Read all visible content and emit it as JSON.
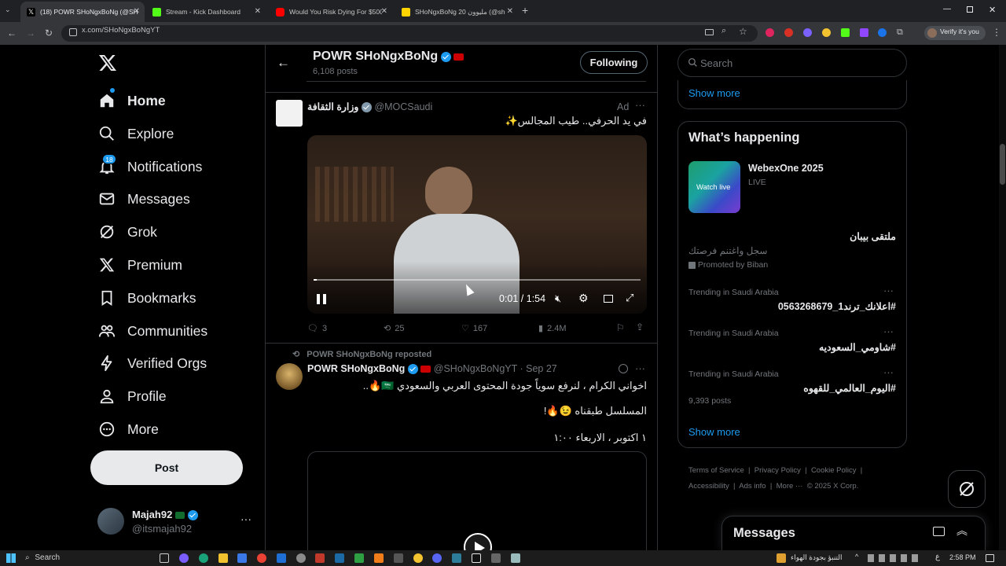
{
  "browser": {
    "tabs": [
      {
        "title": "(18) POWR SHoNgxBoNg (@SH",
        "favicon_color": "#ffffff",
        "active": true
      },
      {
        "title": "Stream - Kick Dashboard",
        "favicon_color": "#53fc18",
        "active": false
      },
      {
        "title": "Would You Risk Dying For $500",
        "favicon_color": "#ff0000",
        "active": false
      },
      {
        "title": "SHoNgxBoNg 20 مليوون (@sh",
        "favicon_color": "#ffd400",
        "active": false
      }
    ],
    "url": "x.com/SHoNgxBoNgYT",
    "profile_label": "Verify it's you"
  },
  "sidebar": {
    "items": [
      {
        "label": "Home",
        "icon": "home-icon"
      },
      {
        "label": "Explore",
        "icon": "search-icon"
      },
      {
        "label": "Notifications",
        "icon": "bell-icon",
        "badge": "18"
      },
      {
        "label": "Messages",
        "icon": "envelope-icon"
      },
      {
        "label": "Grok",
        "icon": "grok-icon"
      },
      {
        "label": "Premium",
        "icon": "x-logo-icon"
      },
      {
        "label": "Bookmarks",
        "icon": "bookmark-icon"
      },
      {
        "label": "Communities",
        "icon": "people-icon"
      },
      {
        "label": "Verified Orgs",
        "icon": "lightning-icon"
      },
      {
        "label": "Profile",
        "icon": "person-icon"
      },
      {
        "label": "More",
        "icon": "more-circle-icon"
      }
    ],
    "post_label": "Post",
    "account": {
      "name": "Majah92",
      "handle": "@itsmajah92"
    }
  },
  "header": {
    "title": "POWR SHoNgxBoNg",
    "posts_count": "6,108 posts",
    "following_label": "Following"
  },
  "ad_tweet": {
    "name": "وزارة الثقافة",
    "handle": "@MOCSaudi",
    "ad_label": "Ad",
    "text": "في يد الحرفي.. طيب المجالس✨",
    "video_time": "0:01 / 1:54",
    "video_progress": 0.01,
    "replies": "3",
    "reposts": "25",
    "likes": "167",
    "views": "2.4M"
  },
  "repost_tweet": {
    "reposted_by": "POWR SHoNgxBoNg reposted",
    "name": "POWR SHoNgxBoNg",
    "handle": "@SHoNgxBoNgYT",
    "date": "· Sep 27",
    "line1": "اخواني الكرام ، لنرفع سوياً جودة المحتوى العربي والسعودي 🇸🇦🔥..",
    "line2": "المسلسل طبقناه 😉🔥!",
    "line3": "١ اكتوبر ، الاربعاء ١:٠٠"
  },
  "right": {
    "search_placeholder": "Search",
    "show_more_top": "Show more",
    "happening_title": "What’s happening",
    "event": {
      "title": "WebexOne 2025",
      "status": "LIVE",
      "thumb_label": "Watch live"
    },
    "promo": {
      "title": "ملتقى بيبان",
      "subtitle": "سجل واغتنم فرصتك",
      "promoted": "Promoted by Biban"
    },
    "trends": [
      {
        "context": "Trending in Saudi Arabia",
        "name": "#اعلانك_ترند1_0563268679",
        "posts": ""
      },
      {
        "context": "Trending in Saudi Arabia",
        "name": "#شاومي_السعوديه",
        "posts": ""
      },
      {
        "context": "Trending in Saudi Arabia",
        "name": "#اليوم_العالمي_للقهوه",
        "posts": "9,393 posts"
      }
    ],
    "show_more": "Show more",
    "footer": [
      "Terms of Service",
      "Privacy Policy",
      "Cookie Policy",
      "Accessibility",
      "Ads info",
      "More ···",
      "© 2025 X Corp."
    ],
    "messages_label": "Messages"
  },
  "taskbar": {
    "search_label": "Search",
    "weather_text": "التنبؤ بجودة الهواء",
    "time": "2:58 PM",
    "lang": "ع"
  }
}
